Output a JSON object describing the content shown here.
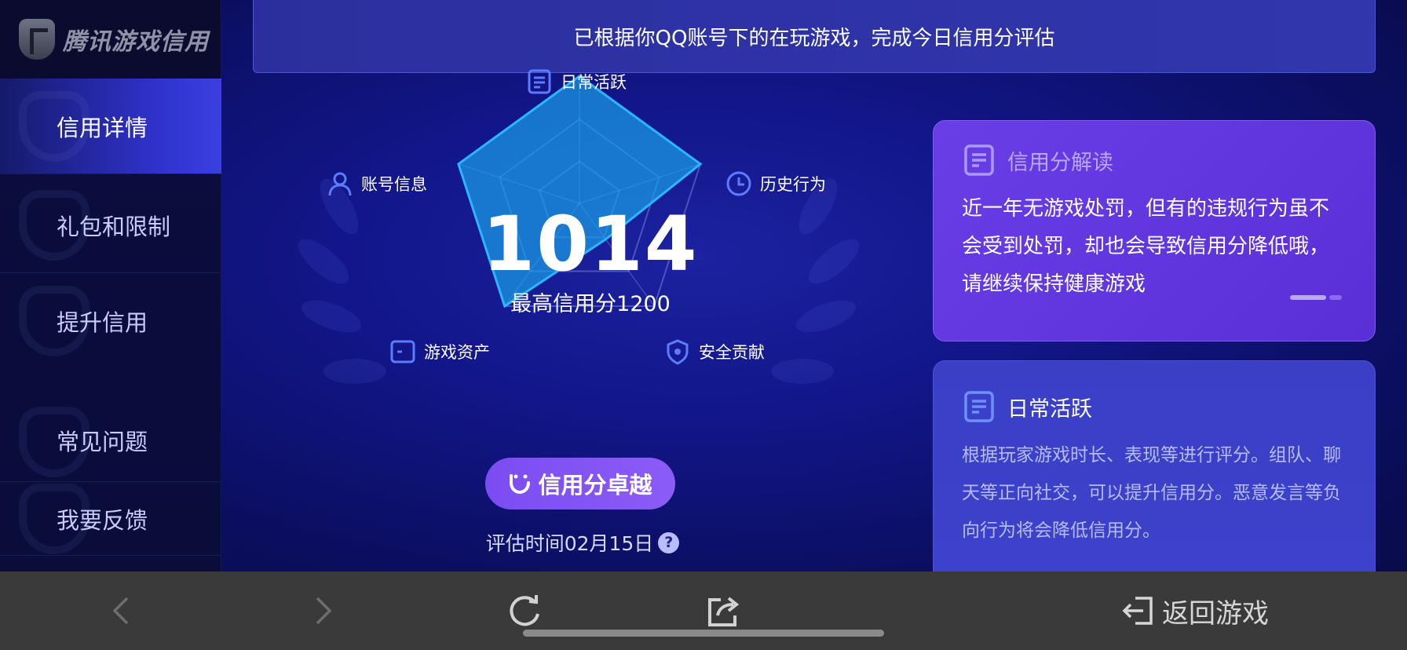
{
  "sidebar": {
    "logo_text": "腾讯游戏信用",
    "items": [
      {
        "label": "信用详情",
        "active": true
      },
      {
        "label": "礼包和限制",
        "active": false
      },
      {
        "label": "提升信用",
        "active": false
      },
      {
        "label": "常见问题",
        "active": false
      },
      {
        "label": "我要反馈",
        "active": false
      }
    ]
  },
  "banner": {
    "text": "已根据你QQ账号下的在玩游戏，完成今日信用分评估"
  },
  "radar": {
    "axes": [
      {
        "label": "日常活跃",
        "icon": "document-icon",
        "value": 1.0
      },
      {
        "label": "历史行为",
        "icon": "clock-icon",
        "value": 1.0
      },
      {
        "label": "安全贡献",
        "icon": "shield-icon",
        "value": 0.35
      },
      {
        "label": "游戏资产",
        "icon": "wallet-icon",
        "value": 1.0
      },
      {
        "label": "账号信息",
        "icon": "user-icon",
        "value": 1.0
      }
    ],
    "score": "1014",
    "max_text": "最高信用分1200"
  },
  "level_button": {
    "label": "信用分卓越",
    "icon": "smile-icon"
  },
  "eval_time": {
    "text": "评估时间02月15日",
    "help": "?"
  },
  "interpretation_card": {
    "title": "信用分解读",
    "icon": "document-icon",
    "body": "近一年无游戏处罚，但有的违规行为虽不会受到处罚，却也会导致信用分降低哦，请继续保持健康游戏"
  },
  "daily_card": {
    "title": "日常活跃",
    "icon": "document-icon",
    "body": "根据玩家游戏时长、表现等进行评分。组队、聊天等正向社交，可以提升信用分。恶意发言等负向行为将会降低信用分。"
  },
  "bottom_bar": {
    "back_icon": "chevron-left-icon",
    "forward_icon": "chevron-right-icon",
    "refresh_icon": "refresh-icon",
    "share_icon": "share-icon",
    "return_label": "返回游戏",
    "return_icon": "exit-icon"
  },
  "colors": {
    "accent_purple": "#7b4cf2",
    "radar_fill": "#1aa0e8",
    "banner_bg": "#2b2f9e",
    "sidebar_active": "#3b3fe0"
  }
}
